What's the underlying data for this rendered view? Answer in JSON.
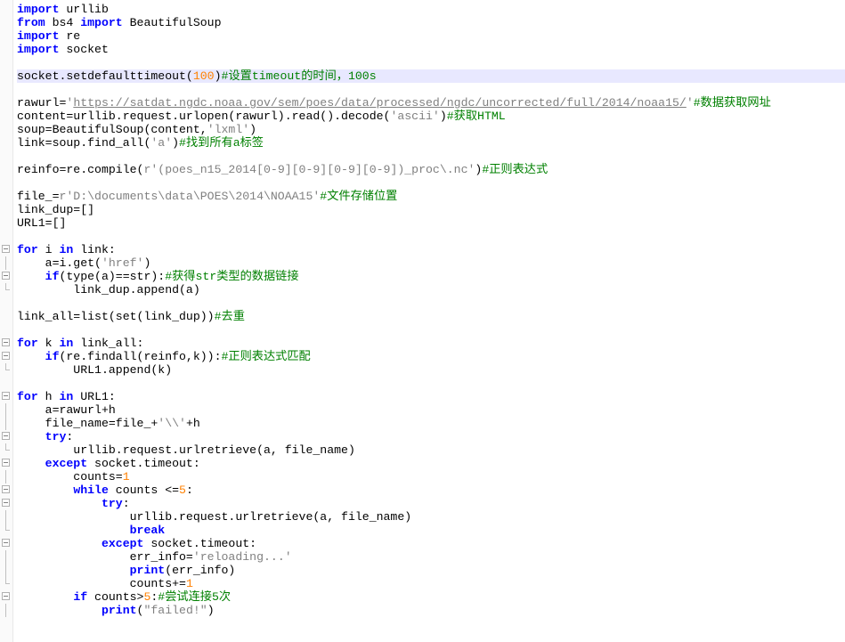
{
  "code": {
    "lines": [
      {
        "t": [
          {
            "c": "kw",
            "v": "import"
          },
          {
            "c": "id",
            "v": " urllib"
          }
        ],
        "g": "blank"
      },
      {
        "t": [
          {
            "c": "kw",
            "v": "from"
          },
          {
            "c": "id",
            "v": " bs4 "
          },
          {
            "c": "kw",
            "v": "import"
          },
          {
            "c": "id",
            "v": " BeautifulSoup"
          }
        ],
        "g": "blank"
      },
      {
        "t": [
          {
            "c": "kw",
            "v": "import"
          },
          {
            "c": "id",
            "v": " re"
          }
        ],
        "g": "blank"
      },
      {
        "t": [
          {
            "c": "kw",
            "v": "import"
          },
          {
            "c": "id",
            "v": " socket"
          }
        ],
        "g": "blank"
      },
      {
        "t": [],
        "g": "blank"
      },
      {
        "t": [
          {
            "c": "id",
            "v": "socket.setdefaulttimeout("
          },
          {
            "c": "num",
            "v": "100"
          },
          {
            "c": "id",
            "v": ")"
          },
          {
            "c": "cmt",
            "v": "#设置timeout的时间，100s"
          }
        ],
        "g": "blank",
        "hl": true
      },
      {
        "t": [],
        "g": "blank"
      },
      {
        "t": [
          {
            "c": "id",
            "v": "rawurl="
          },
          {
            "c": "str",
            "v": "'"
          },
          {
            "c": "urlstr",
            "v": "https://satdat.ngdc.noaa.gov/sem/poes/data/processed/ngdc/uncorrected/full/2014/noaa15/"
          },
          {
            "c": "str",
            "v": "'"
          },
          {
            "c": "cmt",
            "v": "#数据获取网址"
          }
        ],
        "g": "blank"
      },
      {
        "t": [
          {
            "c": "id",
            "v": "content=urllib.request.urlopen(rawurl).read().decode("
          },
          {
            "c": "str",
            "v": "'ascii'"
          },
          {
            "c": "id",
            "v": ")"
          },
          {
            "c": "cmt",
            "v": "#获取HTML"
          }
        ],
        "g": "blank"
      },
      {
        "t": [
          {
            "c": "id",
            "v": "soup=BeautifulSoup(content,"
          },
          {
            "c": "str",
            "v": "'lxml'"
          },
          {
            "c": "id",
            "v": ")"
          }
        ],
        "g": "blank"
      },
      {
        "t": [
          {
            "c": "id",
            "v": "link=soup.find_all("
          },
          {
            "c": "str",
            "v": "'a'"
          },
          {
            "c": "id",
            "v": ")"
          },
          {
            "c": "cmt",
            "v": "#找到所有a标签"
          }
        ],
        "g": "blank"
      },
      {
        "t": [],
        "g": "blank"
      },
      {
        "t": [
          {
            "c": "id",
            "v": "reinfo=re.compile("
          },
          {
            "c": "str",
            "v": "r'(poes_n15_2014[0-9][0-9][0-9][0-9])_proc\\.nc'"
          },
          {
            "c": "id",
            "v": ")"
          },
          {
            "c": "cmt",
            "v": "#正则表达式"
          }
        ],
        "g": "blank"
      },
      {
        "t": [],
        "g": "blank"
      },
      {
        "t": [
          {
            "c": "id",
            "v": "file_="
          },
          {
            "c": "str",
            "v": "r'D:\\documents\\data\\POES\\2014\\NOAA15'"
          },
          {
            "c": "cmt",
            "v": "#文件存储位置"
          }
        ],
        "g": "blank"
      },
      {
        "t": [
          {
            "c": "id",
            "v": "link_dup=[]"
          }
        ],
        "g": "blank"
      },
      {
        "t": [
          {
            "c": "id",
            "v": "URL1=[]"
          }
        ],
        "g": "blank"
      },
      {
        "t": [],
        "g": "blank"
      },
      {
        "t": [
          {
            "c": "kw",
            "v": "for"
          },
          {
            "c": "id",
            "v": " i "
          },
          {
            "c": "kw",
            "v": "in"
          },
          {
            "c": "id",
            "v": " link:"
          }
        ],
        "g": "fold"
      },
      {
        "t": [
          {
            "c": "id",
            "v": "    a=i.get("
          },
          {
            "c": "str",
            "v": "'href'"
          },
          {
            "c": "id",
            "v": ")"
          }
        ],
        "g": "bar"
      },
      {
        "t": [
          {
            "c": "id",
            "v": "    "
          },
          {
            "c": "kw",
            "v": "if"
          },
          {
            "c": "id",
            "v": "(type(a)==str):"
          },
          {
            "c": "cmt",
            "v": "#获得str类型的数据链接"
          }
        ],
        "g": "fold"
      },
      {
        "t": [
          {
            "c": "id",
            "v": "        link_dup.append(a)"
          }
        ],
        "g": "end"
      },
      {
        "t": [],
        "g": "blank"
      },
      {
        "t": [
          {
            "c": "id",
            "v": "link_all=list(set(link_dup))"
          },
          {
            "c": "cmt",
            "v": "#去重"
          }
        ],
        "g": "blank"
      },
      {
        "t": [],
        "g": "blank"
      },
      {
        "t": [
          {
            "c": "kw",
            "v": "for"
          },
          {
            "c": "id",
            "v": " k "
          },
          {
            "c": "kw",
            "v": "in"
          },
          {
            "c": "id",
            "v": " link_all:"
          }
        ],
        "g": "fold"
      },
      {
        "t": [
          {
            "c": "id",
            "v": "    "
          },
          {
            "c": "kw",
            "v": "if"
          },
          {
            "c": "id",
            "v": "(re.findall(reinfo,k)):"
          },
          {
            "c": "cmt",
            "v": "#正则表达式匹配"
          }
        ],
        "g": "fold"
      },
      {
        "t": [
          {
            "c": "id",
            "v": "        URL1.append(k)"
          }
        ],
        "g": "end"
      },
      {
        "t": [],
        "g": "blank"
      },
      {
        "t": [
          {
            "c": "kw",
            "v": "for"
          },
          {
            "c": "id",
            "v": " h "
          },
          {
            "c": "kw",
            "v": "in"
          },
          {
            "c": "id",
            "v": " URL1:"
          }
        ],
        "g": "fold"
      },
      {
        "t": [
          {
            "c": "id",
            "v": "    a=rawurl+h"
          }
        ],
        "g": "bar"
      },
      {
        "t": [
          {
            "c": "id",
            "v": "    file_name=file_+"
          },
          {
            "c": "str",
            "v": "'\\\\'"
          },
          {
            "c": "id",
            "v": "+h"
          }
        ],
        "g": "bar"
      },
      {
        "t": [
          {
            "c": "id",
            "v": "    "
          },
          {
            "c": "kw",
            "v": "try"
          },
          {
            "c": "id",
            "v": ":"
          }
        ],
        "g": "fold"
      },
      {
        "t": [
          {
            "c": "id",
            "v": "        urllib.request.urlretrieve(a, file_name)"
          }
        ],
        "g": "end"
      },
      {
        "t": [
          {
            "c": "id",
            "v": "    "
          },
          {
            "c": "kw",
            "v": "except"
          },
          {
            "c": "id",
            "v": " socket.timeout:"
          }
        ],
        "g": "fold"
      },
      {
        "t": [
          {
            "c": "id",
            "v": "        counts="
          },
          {
            "c": "num",
            "v": "1"
          }
        ],
        "g": "bar"
      },
      {
        "t": [
          {
            "c": "id",
            "v": "        "
          },
          {
            "c": "kw",
            "v": "while"
          },
          {
            "c": "id",
            "v": " counts <="
          },
          {
            "c": "num",
            "v": "5"
          },
          {
            "c": "id",
            "v": ":"
          }
        ],
        "g": "fold"
      },
      {
        "t": [
          {
            "c": "id",
            "v": "            "
          },
          {
            "c": "kw",
            "v": "try"
          },
          {
            "c": "id",
            "v": ":"
          }
        ],
        "g": "fold"
      },
      {
        "t": [
          {
            "c": "id",
            "v": "                urllib.request.urlretrieve(a, file_name)"
          }
        ],
        "g": "bar"
      },
      {
        "t": [
          {
            "c": "id",
            "v": "                "
          },
          {
            "c": "kw",
            "v": "break"
          }
        ],
        "g": "end"
      },
      {
        "t": [
          {
            "c": "id",
            "v": "            "
          },
          {
            "c": "kw",
            "v": "except"
          },
          {
            "c": "id",
            "v": " socket.timeout:"
          }
        ],
        "g": "fold"
      },
      {
        "t": [
          {
            "c": "id",
            "v": "                err_info="
          },
          {
            "c": "str",
            "v": "'reloading...'"
          }
        ],
        "g": "bar"
      },
      {
        "t": [
          {
            "c": "id",
            "v": "                "
          },
          {
            "c": "kw",
            "v": "print"
          },
          {
            "c": "id",
            "v": "(err_info)"
          }
        ],
        "g": "bar"
      },
      {
        "t": [
          {
            "c": "id",
            "v": "                counts+="
          },
          {
            "c": "num",
            "v": "1"
          }
        ],
        "g": "end"
      },
      {
        "t": [
          {
            "c": "id",
            "v": "        "
          },
          {
            "c": "kw",
            "v": "if"
          },
          {
            "c": "id",
            "v": " counts>"
          },
          {
            "c": "num",
            "v": "5"
          },
          {
            "c": "id",
            "v": ":"
          },
          {
            "c": "cmt",
            "v": "#尝试连接5次"
          }
        ],
        "g": "fold"
      },
      {
        "t": [
          {
            "c": "id",
            "v": "            "
          },
          {
            "c": "kw",
            "v": "print"
          },
          {
            "c": "id",
            "v": "("
          },
          {
            "c": "str",
            "v": "\"failed!\""
          },
          {
            "c": "id",
            "v": ")"
          }
        ],
        "g": "bar"
      }
    ]
  }
}
